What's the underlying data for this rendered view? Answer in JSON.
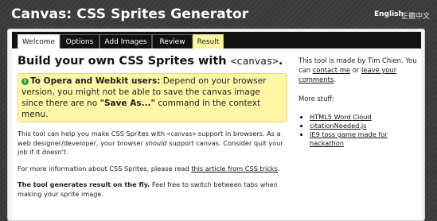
{
  "header": {
    "title": "Canvas: CSS Sprites Generator",
    "lang_en": "English",
    "lang_zh": "正體中文"
  },
  "tabs": [
    {
      "label": "Welcome"
    },
    {
      "label": "Options"
    },
    {
      "label": "Add Images"
    },
    {
      "label": "Review"
    },
    {
      "label": "Result"
    }
  ],
  "main": {
    "heading_text": "Build your own CSS Sprites with ",
    "heading_code": "<canvas>",
    "heading_end": ".",
    "notice_icon": "i",
    "notice_bold": "To Opera and Webkit users:",
    "notice_text": " Depend on your browser version, you might not be able to save the canvas image since there are no ",
    "notice_quote": "\"Save As...\"",
    "notice_end": " command in the context menu.",
    "p1_a": "This tool can help you make CSS Sprites with ",
    "p1_code": "<canvas>",
    "p1_b": " support in browsers. As a web designer/developer, your browser ",
    "p1_em": "should",
    "p1_c": " support canvas. Consider quit your job if it doesn't.",
    "p2_a": "For more information about CSS Sprites, please read ",
    "p2_link": "this article from CSS tricks",
    "p2_b": ".",
    "p3_bold": "The tool generates result on the fly.",
    "p3_text": " Feel free to switch between tabs when making your sprite image."
  },
  "side": {
    "made_by": "This tool is made by Tim Chien. You can ",
    "contact": "contact me",
    "or": " or ",
    "leave": "leave your comments",
    "period": ".",
    "more": "More stuff:",
    "links": [
      "HTML5 Word Cloud",
      "citationNeeded.js",
      "IE9 toss game made for hackathon"
    ]
  },
  "colors": {
    "background": "#3a3a3a",
    "tabbar": "#121212",
    "result_tab": "#fff7a0",
    "notice": "#fff6a6",
    "notice_icon": "#2aa22a"
  }
}
